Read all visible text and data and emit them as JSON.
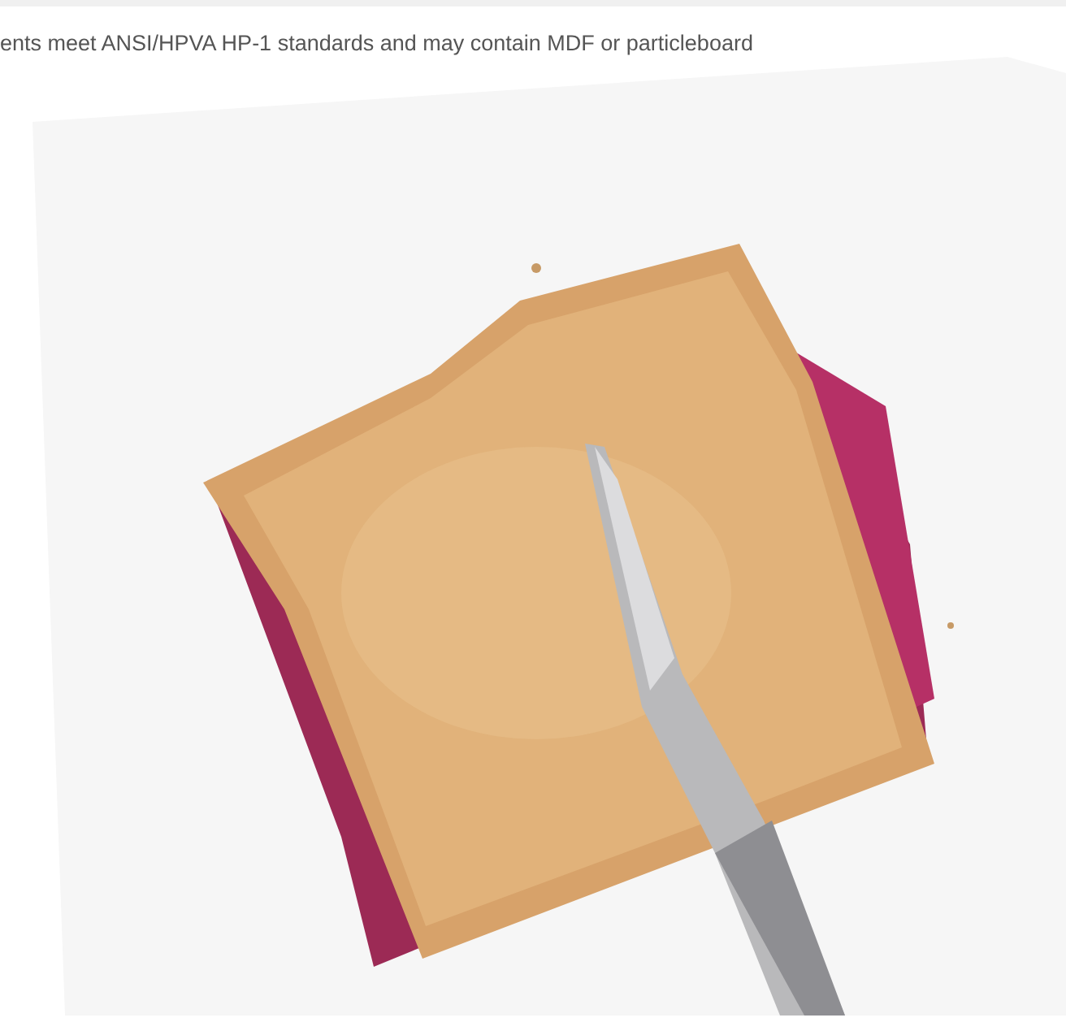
{
  "caption": "ents meet ANSI/HPVA HP-1 standards and may contain MDF or particleboard"
}
